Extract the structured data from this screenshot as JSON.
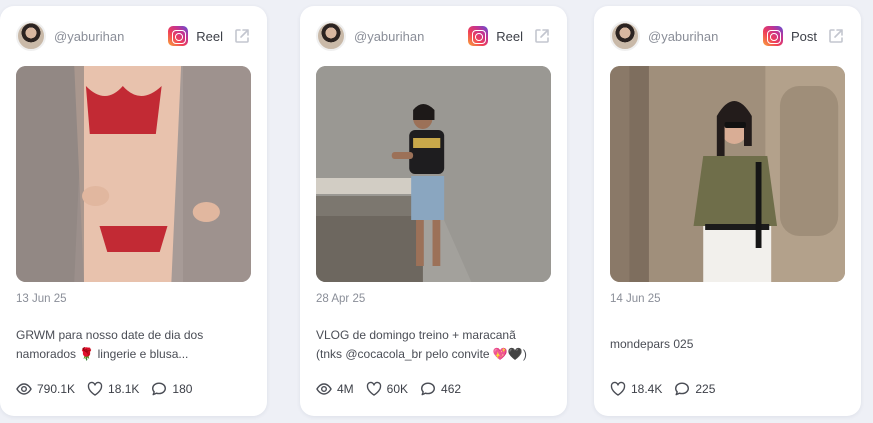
{
  "posts": [
    {
      "username": "@yaburihan",
      "type": "Reel",
      "date": "28 Apr 25",
      "caption_line1": "VLOG de domingo treino + maracanã",
      "caption_line2": "(tnks @cocacola_br pelo convite 💖🖤)",
      "views": "4M",
      "likes": "60K",
      "comments": "462"
    },
    {
      "username": "@yaburihan",
      "type": "Post",
      "date": "14 Jun 25",
      "caption_line1": "mondepars 025",
      "likes": "18.4K",
      "comments": "225"
    },
    {
      "username": "@yaburihan",
      "type": "Reel",
      "date": "13 Jun 25",
      "caption_line1": "GRWM para nosso date de dia dos",
      "caption_line2": "namorados 🌹 lingerie e blusa...",
      "views": "790.1K",
      "likes": "18.1K",
      "comments": "180"
    }
  ],
  "icons": {
    "platform": "instagram-icon",
    "external": "external-link-icon",
    "views": "eye-icon",
    "likes": "heart-icon",
    "comments": "comment-icon"
  }
}
